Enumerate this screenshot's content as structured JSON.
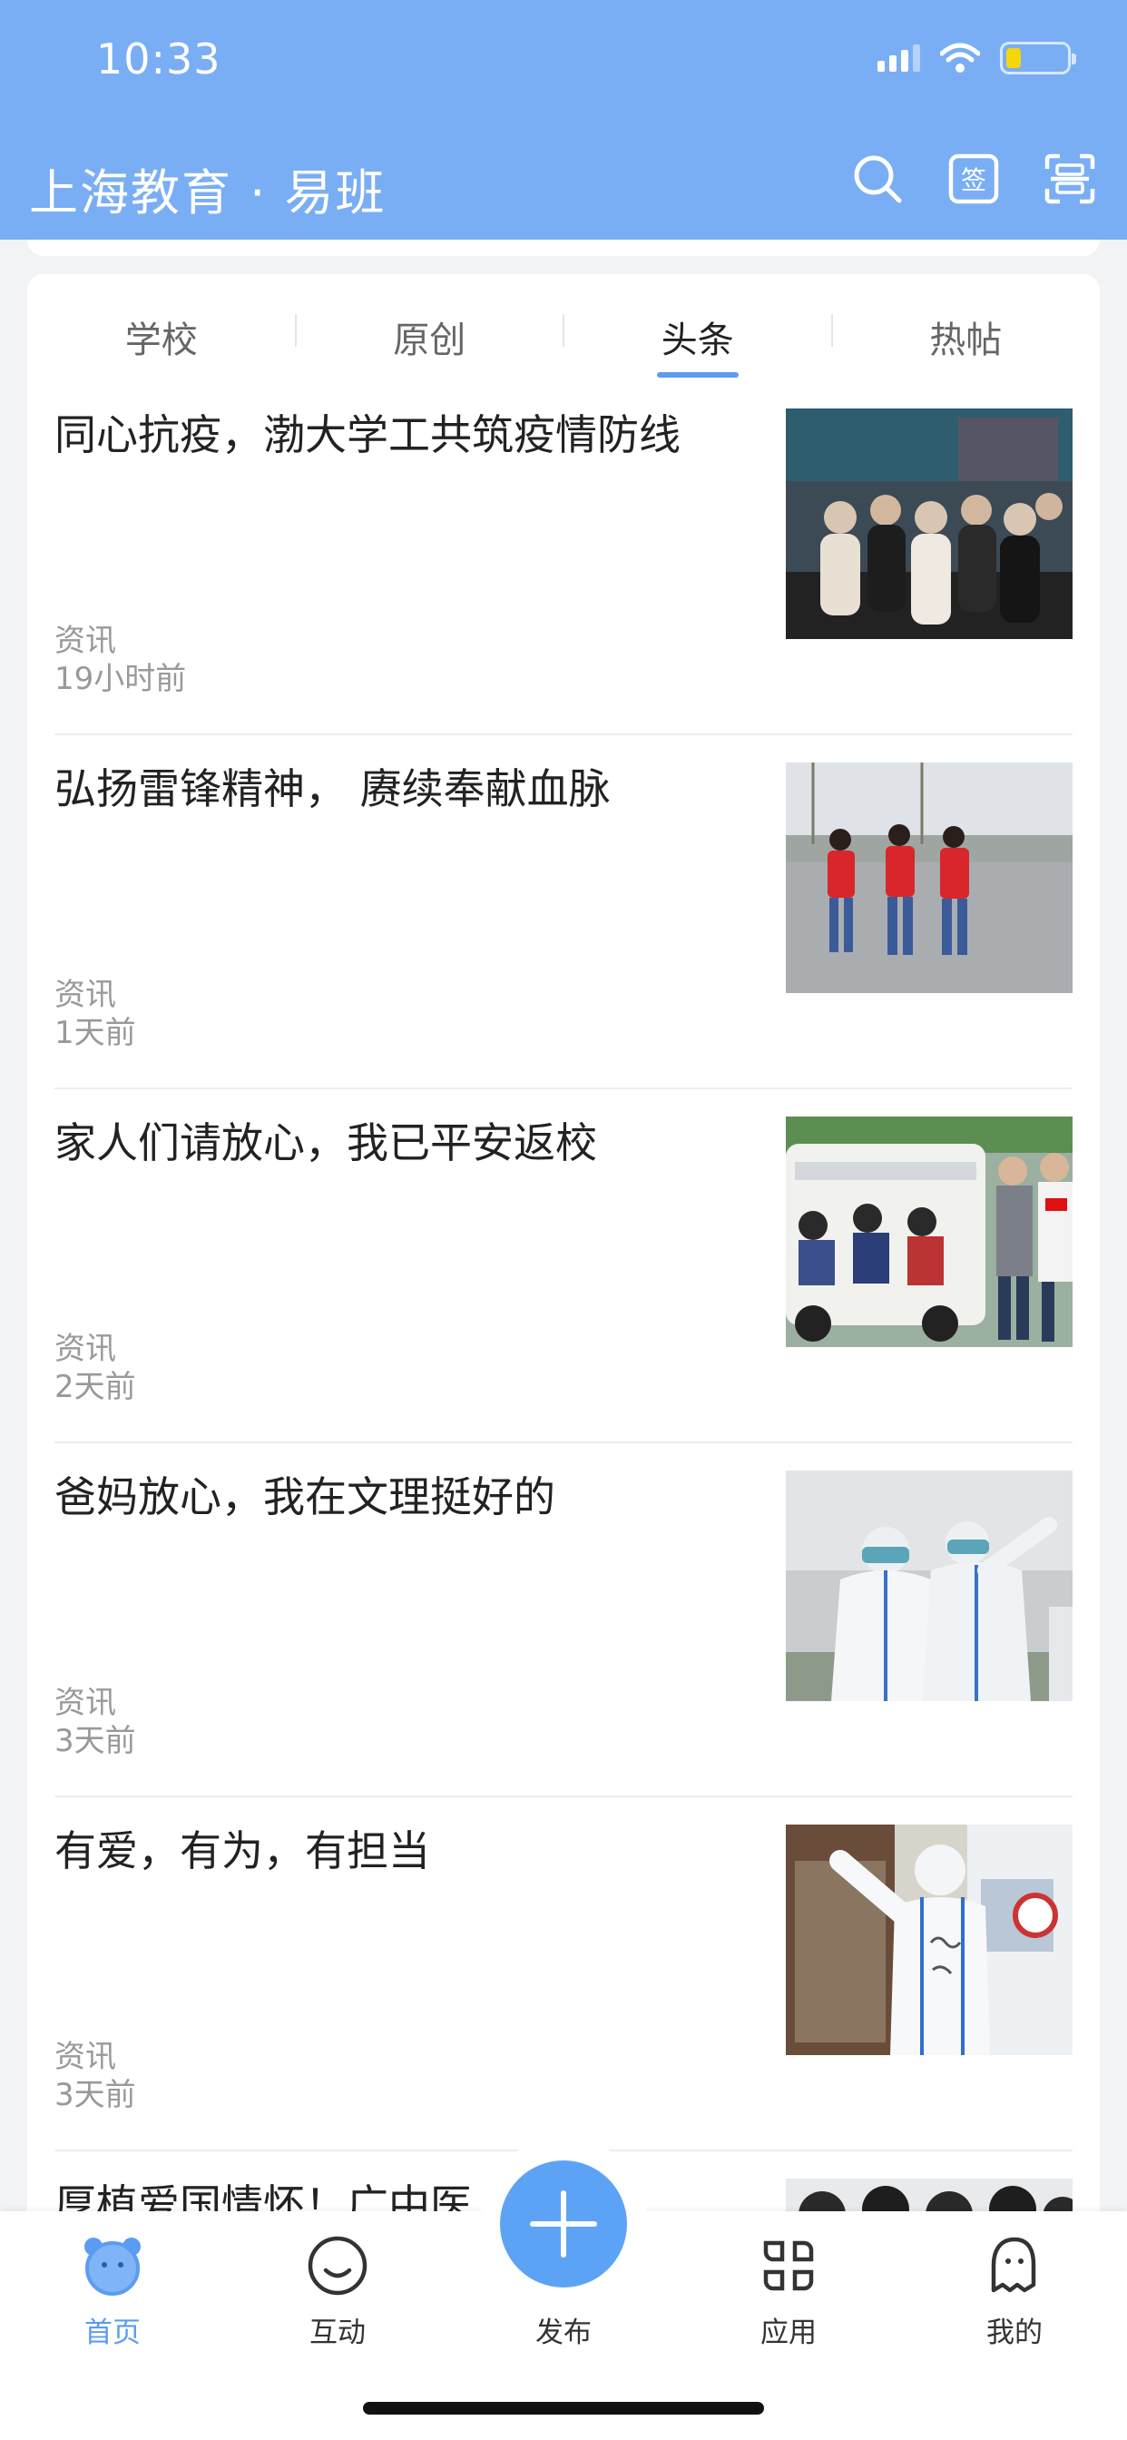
{
  "status_bar": {
    "time": "10:33"
  },
  "header": {
    "title": "上海教育 · 易班",
    "icons": [
      "search-icon",
      "sign-in-icon",
      "scan-icon"
    ]
  },
  "tabs": [
    {
      "label": "学校",
      "active": false
    },
    {
      "label": "原创",
      "active": false
    },
    {
      "label": "头条",
      "active": true
    },
    {
      "label": "热帖",
      "active": false
    }
  ],
  "articles": [
    {
      "title": "同心抗疫，渤大学工共筑疫情防线",
      "category": "资讯",
      "time": "19小时前"
    },
    {
      "title": "弘扬雷锋精神， 赓续奉献血脉",
      "category": "资讯",
      "time": "1天前"
    },
    {
      "title": "家人们请放心，我已平安返校",
      "category": "资讯",
      "time": "2天前"
    },
    {
      "title": "爸妈放心，我在文理挺好的",
      "category": "资讯",
      "time": "3天前"
    },
    {
      "title": "有爱，有为，有担当",
      "category": "资讯",
      "time": "3天前"
    },
    {
      "title": "厚植爱国情怀！广中医",
      "category": "",
      "time": ""
    }
  ],
  "bottom_nav": {
    "home": "首页",
    "interact": "互动",
    "publish": "发布",
    "apps": "应用",
    "mine": "我的"
  },
  "colors": {
    "header": "#7aaef4",
    "accent": "#5b9cf2",
    "fab": "#5da3f5"
  }
}
